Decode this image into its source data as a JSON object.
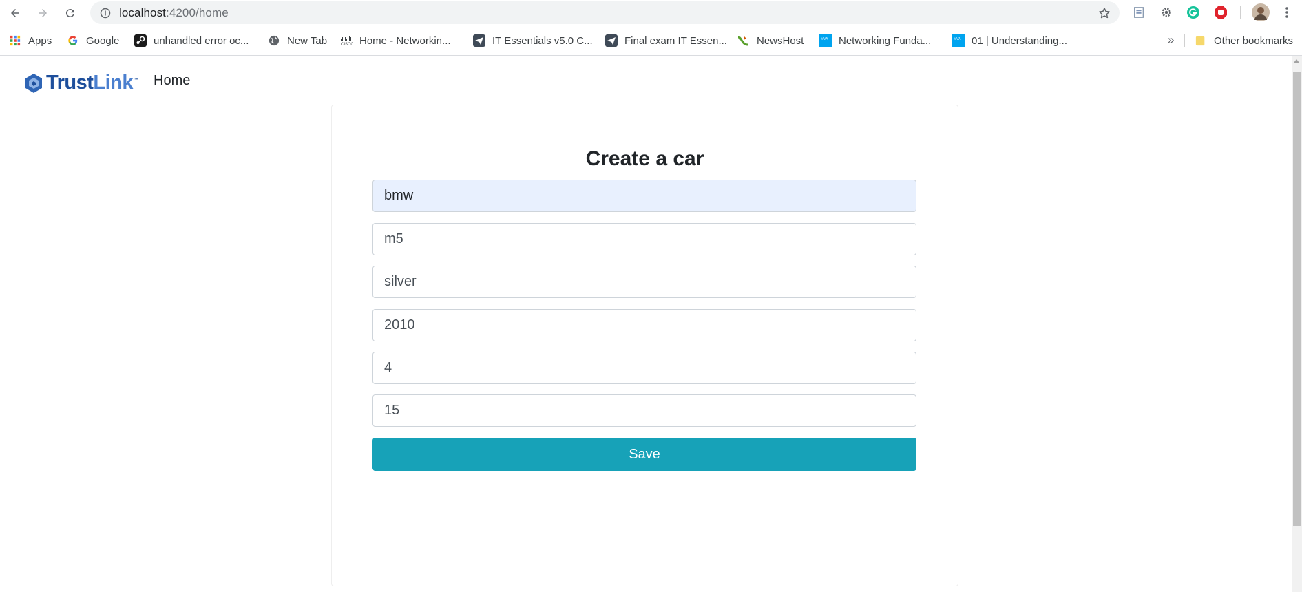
{
  "browser": {
    "url_host": "localhost",
    "url_path": ":4200/home",
    "bookmarks": [
      {
        "label": "Apps",
        "icon": "apps-grid-icon"
      },
      {
        "label": "Google",
        "icon": "google-icon"
      },
      {
        "label": "unhandled error oc...",
        "icon": "steam-icon"
      },
      {
        "label": "New Tab",
        "icon": "globe-icon"
      },
      {
        "label": "Home - Networkin...",
        "icon": "cisco-icon"
      },
      {
        "label": "IT Essentials v5.0 C...",
        "icon": "send-icon"
      },
      {
        "label": "Final exam IT Essen...",
        "icon": "send-icon"
      },
      {
        "label": "NewsHost",
        "icon": "newshost-icon"
      },
      {
        "label": "Networking Funda...",
        "icon": "mva-icon"
      },
      {
        "label": "01 | Understanding...",
        "icon": "mva-icon"
      }
    ],
    "more_bookmarks": "»",
    "other_bookmarks": "Other bookmarks"
  },
  "header": {
    "brand_trust": "Trust",
    "brand_link": "Link",
    "brand_tm": "™",
    "nav_home": "Home"
  },
  "form": {
    "title": "Create a car",
    "fields": [
      {
        "value": "bmw"
      },
      {
        "value": "m5"
      },
      {
        "value": "silver"
      },
      {
        "value": "2010"
      },
      {
        "value": "4"
      },
      {
        "value": "15"
      }
    ],
    "save_label": "Save"
  },
  "colors": {
    "accent": "#17a2b8",
    "brand": "#1e4f9c",
    "autofill": "#e8f0fe"
  }
}
